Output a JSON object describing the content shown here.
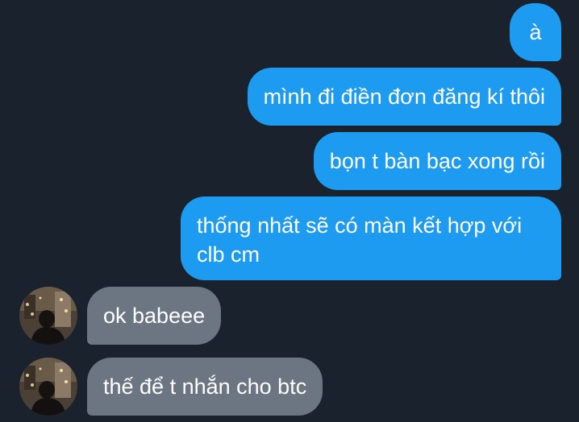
{
  "conversation": {
    "messages": [
      {
        "sender": "me",
        "text": "à"
      },
      {
        "sender": "me",
        "text": "mình đi điền đơn đăng kí thôi"
      },
      {
        "sender": "me",
        "text": "bọn t bàn bạc xong rồi"
      },
      {
        "sender": "me",
        "text": "thống nhất sẽ có màn kết hợp với clb cm"
      },
      {
        "sender": "them",
        "text": "ok babeee"
      },
      {
        "sender": "them",
        "text": "thế để t nhắn cho btc"
      }
    ]
  }
}
